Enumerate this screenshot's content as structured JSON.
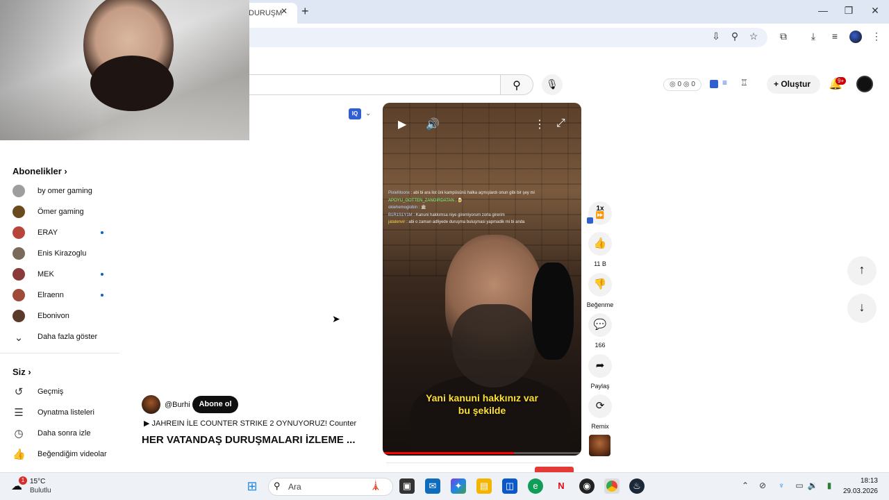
{
  "browser": {
    "tab_title": "DURUŞM",
    "tab_close": "✕",
    "new_tab": "+",
    "window_controls": {
      "minimize": "—",
      "maximize": "❐",
      "close": "✕"
    },
    "toolbar_icons": [
      "install-icon",
      "zoom-icon",
      "bookmark-star-icon",
      "extensions-icon",
      "download-icon",
      "media-icon",
      "profile-avatar",
      "menu-icon"
    ]
  },
  "header": {
    "search_placeholder": "",
    "search_icon": "⚲",
    "mic_icon": "🎙",
    "ext_stats": "◎ 0  ◎ 0",
    "create_label": "+ Oluştur",
    "bell_badge": "9+"
  },
  "sidebar": {
    "subscriptions_title": "Abonelikler  ›",
    "subscriptions": [
      {
        "name": "by omer gaming",
        "live_dot": false,
        "color": "#9e9e9e"
      },
      {
        "name": "Ömer gaming",
        "live_dot": false,
        "color": "#6b4a1e"
      },
      {
        "name": "ERAY",
        "live_dot": true,
        "color": "#b8453a"
      },
      {
        "name": "Enis Kirazoglu",
        "live_dot": false,
        "color": "#7a6a5a"
      },
      {
        "name": "MEK",
        "live_dot": true,
        "color": "#8a3a3a"
      },
      {
        "name": "Elraenn",
        "live_dot": true,
        "color": "#a04a3a"
      },
      {
        "name": "Ebonivon",
        "live_dot": false,
        "color": "#5a3a2a"
      }
    ],
    "show_more": "Daha fazla göster",
    "you_title": "Siz  ›",
    "you_items": [
      {
        "label": "Geçmiş",
        "icon": "history-icon"
      },
      {
        "label": "Oynatma listeleri",
        "icon": "playlist-icon"
      },
      {
        "label": "Daha sonra izle",
        "icon": "clock-icon"
      },
      {
        "label": "Beğendiğim videolar",
        "icon": "like-icon"
      }
    ]
  },
  "short": {
    "chat": [
      {
        "user": "PixieMoonx",
        "msg": "abi bi ara list üni kampüsünü halka açmışlardı onun gibi bir şey mi",
        "cls": "u3"
      },
      {
        "user": "APOYU_GOTTEN_ZANGIRDATAN",
        "msg": "🍺",
        "cls": "u2"
      },
      {
        "user": "okiehemoglobin",
        "msg": "🏛",
        "cls": "u3"
      },
      {
        "user": "B1R1S1Y1M",
        "msg": "Kanuni hakkımsa niye giremiyorum zorla girerim",
        "cls": "u3"
      },
      {
        "user": "jatatenvir",
        "msg": "abi o zaman adliyede duruşma buluşmasi yapmadik mi bi anda",
        "cls": "u1"
      }
    ],
    "caption_line1": "Yani kanuni hakkınız var",
    "caption_line2": "bu şekilde",
    "progress_fraction": 0.66
  },
  "actions": {
    "speed": "1x",
    "likes": "11 B",
    "dislike_label": "Beğenme",
    "comments": "166",
    "share_label": "Paylaş",
    "remix_label": "Remix"
  },
  "channel": {
    "name": "@Burhi",
    "subscribe_label": "Abone ol",
    "linked_video": "JAHREIN İLE COUNTER STRIKE 2 OYNUYORUZ! Counter",
    "title": "HER VATANDAŞ DURUŞMALARI İZLEME ..."
  },
  "extension": {
    "iq_label": "IQ"
  },
  "taskbar": {
    "weather_badge": "1",
    "temperature": "15°C",
    "weather": "Bulutlu",
    "search_label": "Ara",
    "time": "18:13",
    "date": "29.03.2026"
  }
}
